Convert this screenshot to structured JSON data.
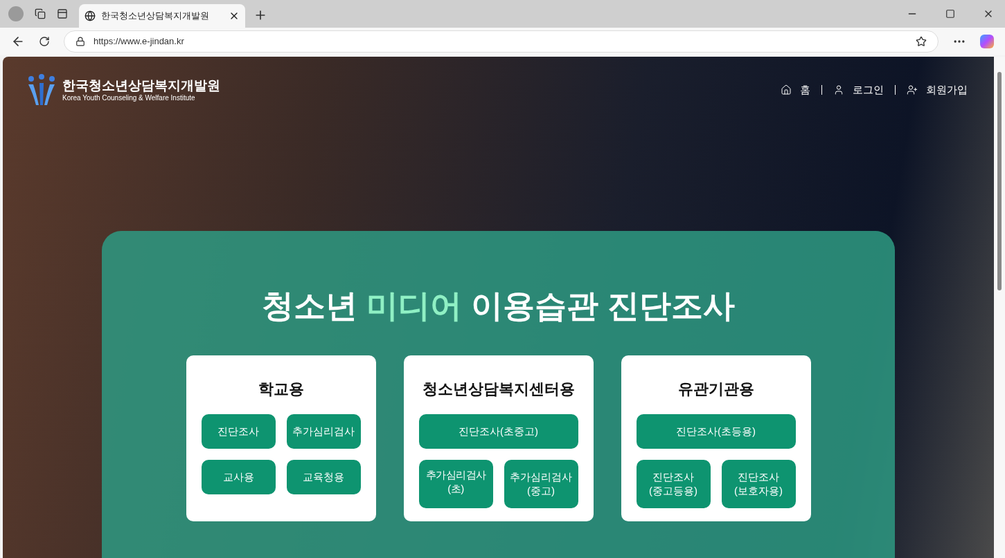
{
  "browser": {
    "tab_title": "한국청소년상담복지개발원",
    "url": "https://www.e-jindan.kr"
  },
  "header": {
    "logo_name": "한국청소년상담복지개발원",
    "logo_subtitle": "Korea Youth Counseling & Welfare Institute",
    "nav": [
      {
        "kind": "home",
        "label": "홈"
      },
      {
        "kind": "login",
        "label": "로그인"
      },
      {
        "kind": "signup",
        "label": "회원가입"
      }
    ]
  },
  "hero": {
    "title": [
      {
        "text": "청소년 ",
        "highlight": false
      },
      {
        "text": "미디어",
        "highlight": true
      },
      {
        "text": " 이용습관 진단조사",
        "highlight": false
      }
    ],
    "cards": [
      {
        "title": "학교용",
        "buttons": [
          {
            "label": "진단조사",
            "kind": "half"
          },
          {
            "label": "추가심리검사",
            "kind": "half"
          },
          {
            "label": "교사용",
            "kind": "half"
          },
          {
            "label": "교육청용",
            "kind": "half"
          }
        ]
      },
      {
        "title": "청소년상담복지센터용",
        "buttons": [
          {
            "label": "진단조사(초중고)",
            "kind": "full"
          },
          {
            "label": "추가심리검사(초)",
            "kind": "tall-top"
          },
          {
            "label": "추가심리검사\n(중고)",
            "kind": "tall"
          }
        ]
      },
      {
        "title": "유관기관용",
        "buttons": [
          {
            "label": "진단조사(초등용)",
            "kind": "full"
          },
          {
            "label": "진단조사\n(중고등용)",
            "kind": "tall"
          },
          {
            "label": "진단조사\n(보호자용)",
            "kind": "tall"
          }
        ]
      }
    ]
  }
}
